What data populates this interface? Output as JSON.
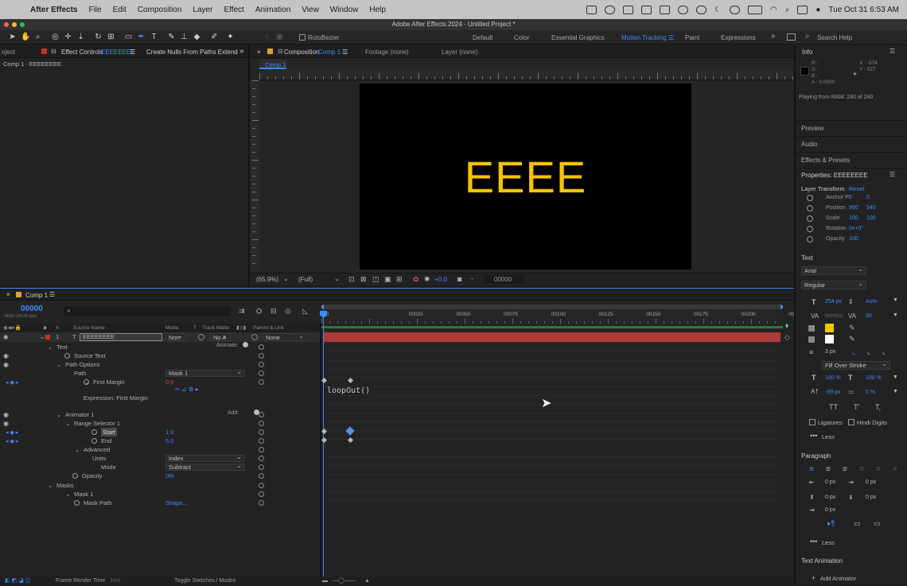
{
  "menubar": {
    "app": "After Effects",
    "items": [
      "File",
      "Edit",
      "Composition",
      "Layer",
      "Effect",
      "Animation",
      "View",
      "Window",
      "Help"
    ],
    "clock": "Tue Oct 31  6:53 AM"
  },
  "window": {
    "title": "Adobe After Effects 2024 - Untitled Project *"
  },
  "toolbar": {
    "roto_label": "RotoBezier",
    "workspaces": [
      "Default",
      "Color",
      "Essential Graphics",
      "Motion Tracking",
      "Paint",
      "Expressions"
    ],
    "active_workspace": "Motion Tracking",
    "search_placeholder": "Search Help"
  },
  "left_panel": {
    "tab_project": "oject",
    "tab_effect_controls": "Effect Controls",
    "tab_effect_layer": "EEEEEEEE",
    "tab_nulls": "Create Nulls From Paths Extend",
    "breadcrumb": "Comp 1 - EEEEEEEE"
  },
  "composition": {
    "tab_label": "Composition",
    "tab_comp": "Comp 1",
    "tab_footage": "Footage (none)",
    "tab_layer": "Layer (none)",
    "sub_tab": "Comp 1",
    "text": "EEEE",
    "text_color": "#f5c400",
    "zoom": "(65.9%)",
    "resolution": "(Full)",
    "exposure": "+0.0",
    "timecode": "00000"
  },
  "timeline": {
    "tab": "Comp 1",
    "timecode": "00000",
    "fps": "0000 (24.00 fps)",
    "columns": {
      "source": "Source Name",
      "mode": "Mode",
      "t": "T",
      "trackmatte": "Track Matte",
      "parent": "Parent & Link"
    },
    "layer": {
      "index": "1",
      "name": "EEEEEEEE",
      "mode": "Norr",
      "matte": "No A",
      "parent": "None"
    },
    "rows": {
      "text": "Text",
      "animate": "Animate:",
      "source_text": "Source Text",
      "path_options": "Path Options",
      "path": "Path",
      "path_value": "Mask 1",
      "first_margin": "First Margin",
      "first_margin_value": "0.0",
      "expression_label": "Expression: First Margin",
      "animator": "Animator 1",
      "add": "Add:",
      "range_selector": "Range Selector 1",
      "start": "Start",
      "start_value": "1.0",
      "end": "End",
      "end_value": "5.0",
      "advanced": "Advanced",
      "units": "Units",
      "units_value": "Index",
      "mode": "Mode",
      "mode_value": "Subtract",
      "opacity": "Opacity",
      "opacity_value": "0%",
      "masks": "Masks",
      "mask1": "Mask 1",
      "mask_path": "Mask Path",
      "mask_path_value": "Shape..."
    },
    "ruler_labels": [
      "00",
      "00025",
      "00050",
      "00075",
      "00100",
      "00125",
      "00150",
      "00175",
      "00200",
      "00225"
    ],
    "expression": "loopOut()",
    "footer_left": "Frame Render Time",
    "footer_ms": "1ms",
    "footer_toggle": "Toggle Switches / Modes",
    "layer_bar_color": "#b03a3a"
  },
  "right_panel": {
    "info": "Info",
    "rgba": [
      "R :",
      "G :",
      "B :",
      "A :  0.0000"
    ],
    "xy": [
      "X : -374",
      "Y : 527"
    ],
    "playing": "Playing from RAM: 240 of 240",
    "preview": "Preview",
    "audio": "Audio",
    "effects_presets": "Effects & Presets",
    "properties": "Properties: EEEEEEEE",
    "layer_transform": "Layer Transform",
    "reset": "Reset",
    "anchor": "Anchor Pt",
    "anchor_x": "0",
    "anchor_y": "0",
    "position": "Position",
    "pos_x": "960",
    "pos_y": "540",
    "scale": "Scale",
    "scale_x": "100",
    "scale_y": "100",
    "rotation": "Rotation",
    "rotation_value": "0x+0°",
    "opacity": "Opacity",
    "opacity_value": "100",
    "text_section": "Text",
    "font": "Arial",
    "style": "Regular",
    "size": "254 px",
    "leading": "Auto",
    "metrics": "Metrics",
    "tracking": "30",
    "stroke": "3 px",
    "fill_over": "Fill Over Stroke",
    "vscale": "100 %",
    "hscale": "100 %",
    "baseline": "-89 px",
    "tsume": "0 %",
    "ligatures": "Ligatures",
    "hindi": "Hindi Digits",
    "less": "Less",
    "paragraph": "Paragraph",
    "indent": [
      "0 px",
      "0 px",
      "0 px",
      "0 px",
      "0 px"
    ],
    "text_animation": "Text Animation",
    "add_animator": "Add Animator",
    "fill_color": "#f5c400",
    "stroke_color": "#ffffff"
  }
}
